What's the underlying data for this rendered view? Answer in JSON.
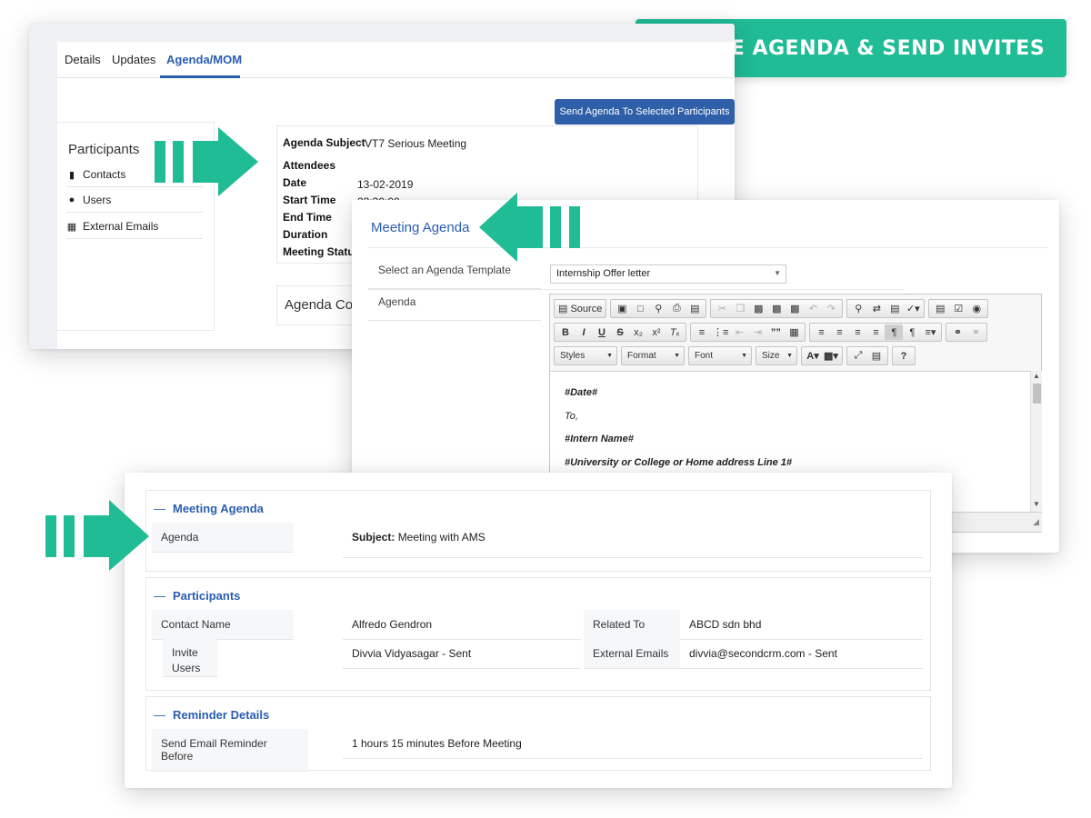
{
  "banner": {
    "text": "CREATE AGENDA & SEND INVITES"
  },
  "detail_view": {
    "tabs": [
      {
        "label": "Details"
      },
      {
        "label": "Updates"
      },
      {
        "label": "Agenda/MOM"
      }
    ],
    "send_button": "Send Agenda To Selected Participants",
    "participants": {
      "title": "Participants",
      "items": [
        {
          "label": "Contacts",
          "icon": "address-book-icon"
        },
        {
          "label": "Users",
          "icon": "user-icon"
        },
        {
          "label": "External Emails",
          "icon": "external-email-icon"
        }
      ]
    },
    "agenda_fields": [
      {
        "label": "Agenda Subject",
        "value": "VT7 Serious Meeting"
      },
      {
        "label": "Attendees",
        "value": ""
      },
      {
        "label": "Date",
        "value": "13-02-2019"
      },
      {
        "label": "Start Time",
        "value": "22:30:00"
      },
      {
        "label": "End Time",
        "value": ""
      },
      {
        "label": "Duration",
        "value": ""
      },
      {
        "label": "Meeting Status",
        "value": ""
      }
    ],
    "agenda_content_title": "Agenda Co"
  },
  "meeting_agenda_editor": {
    "title": "Meeting Agenda",
    "template_label": "Select an Agenda Template",
    "template_value": "Internship Offer letter",
    "agenda_label": "Agenda",
    "toolbar": {
      "source_label": "Source",
      "styles_label": "Styles",
      "format_label": "Format",
      "font_label": "Font",
      "size_label": "Size",
      "bold": "B",
      "italic": "I",
      "underline": "U",
      "strike": "S",
      "help": "?"
    },
    "content_lines": [
      "#Date#",
      "To,",
      "#Intern Name#",
      "#University or College or Home address Line 1#"
    ]
  },
  "summary": {
    "sections": [
      {
        "title": "Meeting Agenda",
        "agenda_label": "Agenda",
        "subject_prefix": "Subject:",
        "subject_value": "Meeting with AMS"
      },
      {
        "title": "Participants",
        "contact_name_label": "Contact Name",
        "contact_name_value": "Alfredo Gendron",
        "related_to_label": "Related To",
        "related_to_value": "ABCD sdn bhd",
        "invite_users_label_1": "Invite",
        "invite_users_label_2": "Users",
        "invite_users_value": "Divvia Vidyasagar - Sent",
        "external_emails_label": "External Emails",
        "external_emails_value": "divvia@secondcrm.com - Sent"
      },
      {
        "title": "Reminder Details",
        "reminder_label": "Send Email Reminder Before",
        "reminder_value": "1 hours 15 minutes Before Meeting"
      }
    ]
  },
  "colors": {
    "accent_green": "#1fbc96",
    "link_blue": "#2a5db0",
    "button_blue": "#2e5fa8"
  }
}
